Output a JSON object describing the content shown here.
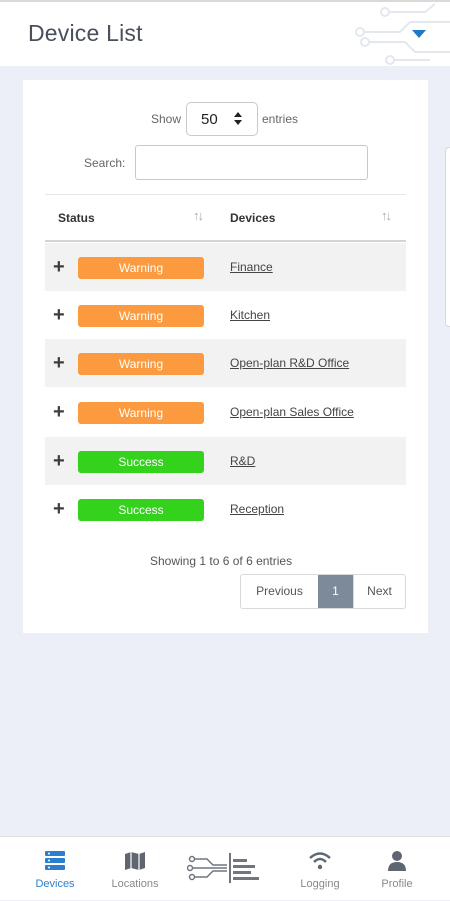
{
  "header": {
    "title": "Device List",
    "dropdown_icon": "caret-down-icon",
    "accent_color": "#1f78c8"
  },
  "table_controls": {
    "show_label": "Show",
    "entries_value": "50",
    "entries_label": "entries",
    "search_label": "Search:",
    "search_value": "",
    "search_placeholder": ""
  },
  "table": {
    "columns": [
      "Status",
      "Devices"
    ],
    "rows": [
      {
        "status": "Warning",
        "device": "Finance"
      },
      {
        "status": "Warning",
        "device": "Kitchen"
      },
      {
        "status": "Warning",
        "device": "Open-plan R&D Office"
      },
      {
        "status": "Warning",
        "device": "Open-plan Sales Office"
      },
      {
        "status": "Success",
        "device": "R&D"
      },
      {
        "status": "Success",
        "device": "Reception"
      }
    ],
    "status_colors": {
      "Warning": "#fb9a3f",
      "Success": "#34d11d"
    }
  },
  "pagination": {
    "info": "Showing 1 to 6 of 6 entries",
    "previous": "Previous",
    "current": "1",
    "next": "Next"
  },
  "bottom_nav": {
    "items": [
      {
        "label": "Devices",
        "icon": "devices-icon",
        "active": true
      },
      {
        "label": "Locations",
        "icon": "map-icon",
        "active": false
      },
      {
        "label": "",
        "icon": "circuit-logo-icon",
        "active": false
      },
      {
        "label": "Logging",
        "icon": "wifi-icon",
        "active": false
      },
      {
        "label": "Profile",
        "icon": "user-icon",
        "active": false
      }
    ],
    "active_color": "#2b7fd1"
  }
}
